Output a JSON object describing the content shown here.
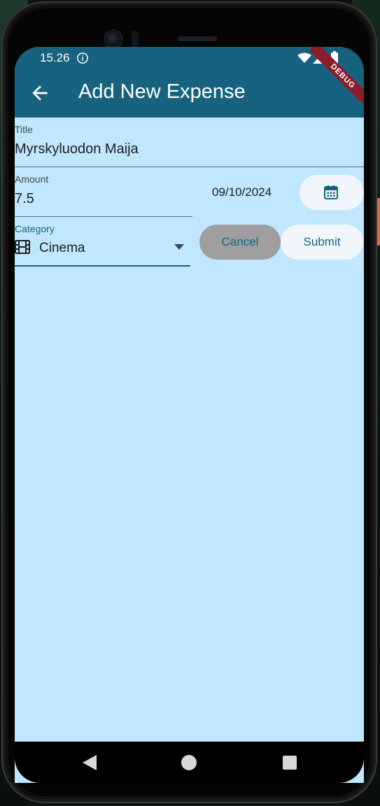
{
  "status_bar": {
    "time": "15.26"
  },
  "debug_banner": "DEBUG",
  "app_bar": {
    "title": "Add New Expense"
  },
  "form": {
    "title_field": {
      "label": "Title",
      "value": "Myrskyluodon Maija"
    },
    "amount_field": {
      "label": "Amount",
      "value": "7.5"
    },
    "date": {
      "value": "09/10/2024"
    },
    "category_field": {
      "label": "Category",
      "selected": "Cinema",
      "icon": "film-icon"
    },
    "cancel_label": "Cancel",
    "submit_label": "Submit"
  },
  "colors": {
    "app_bar": "#17637f",
    "screen_background": "#c0e7fd",
    "button_background": "#f1f6fa",
    "cancel_background": "#9e9e9e",
    "debug_banner": "#8b1d2a"
  }
}
